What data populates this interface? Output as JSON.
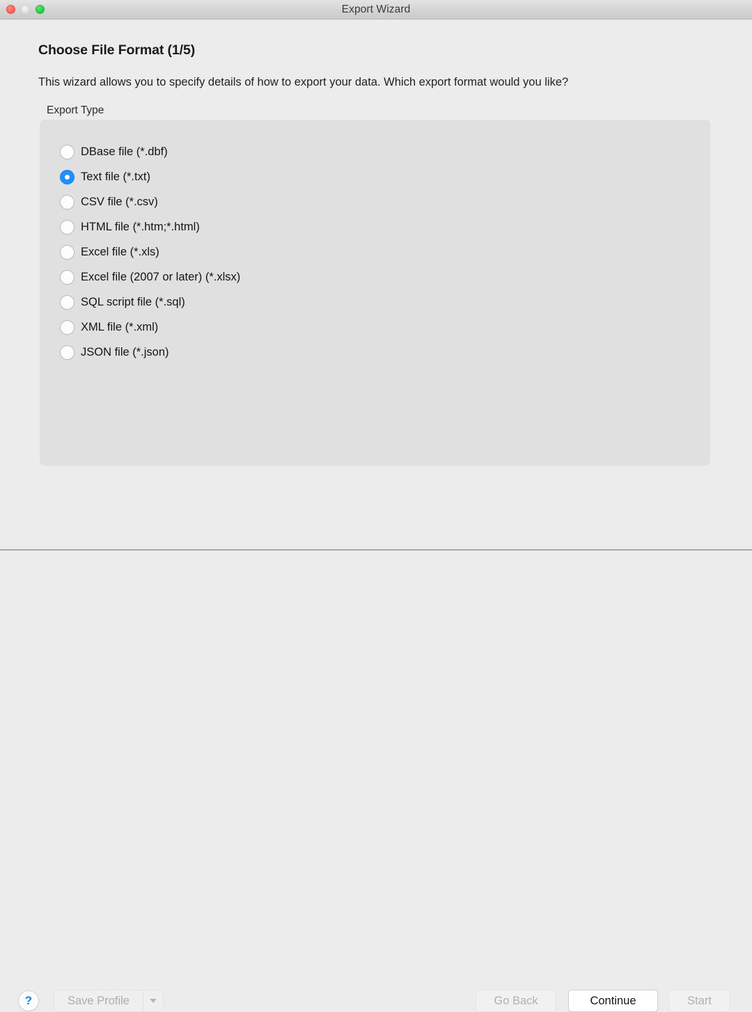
{
  "window": {
    "title": "Export Wizard",
    "controls": {
      "close": "close-button",
      "minimize": "minimize-button",
      "maximize": "maximize-button"
    }
  },
  "page": {
    "title": "Choose File Format (1/5)",
    "description": "This wizard allows you to specify details of how to export your data. Which export format would you like?",
    "step_current": 1,
    "step_total": 5
  },
  "export_type": {
    "group_label": "Export Type",
    "selected_value": "txt",
    "options": [
      {
        "label": "DBase file (*.dbf)",
        "value": "dbf",
        "selected": false
      },
      {
        "label": "Text file (*.txt)",
        "value": "txt",
        "selected": true
      },
      {
        "label": "CSV file (*.csv)",
        "value": "csv",
        "selected": false
      },
      {
        "label": "HTML file (*.htm;*.html)",
        "value": "html",
        "selected": false
      },
      {
        "label": "Excel file (*.xls)",
        "value": "xls",
        "selected": false
      },
      {
        "label": "Excel file (2007 or later) (*.xlsx)",
        "value": "xlsx",
        "selected": false
      },
      {
        "label": "SQL script file (*.sql)",
        "value": "sql",
        "selected": false
      },
      {
        "label": "XML file (*.xml)",
        "value": "xml",
        "selected": false
      },
      {
        "label": "JSON file (*.json)",
        "value": "json",
        "selected": false
      }
    ]
  },
  "footer": {
    "help_label": "?",
    "save_profile_label": "Save Profile",
    "save_profile_enabled": false,
    "dropdown_icon": "chevron-down-icon",
    "go_back_label": "Go Back",
    "go_back_enabled": false,
    "continue_label": "Continue",
    "continue_enabled": true,
    "start_label": "Start",
    "start_enabled": false
  },
  "colors": {
    "accent_blue": "#1e8fff",
    "help_blue": "#1a84ff",
    "window_bg": "#ececec",
    "panel_bg": "#e0e0e0",
    "titlebar_bg": "#d4d4d4",
    "close_red": "#fc6058",
    "maximize_green": "#28cd41",
    "minimize_gray": "#e4e4e4"
  }
}
